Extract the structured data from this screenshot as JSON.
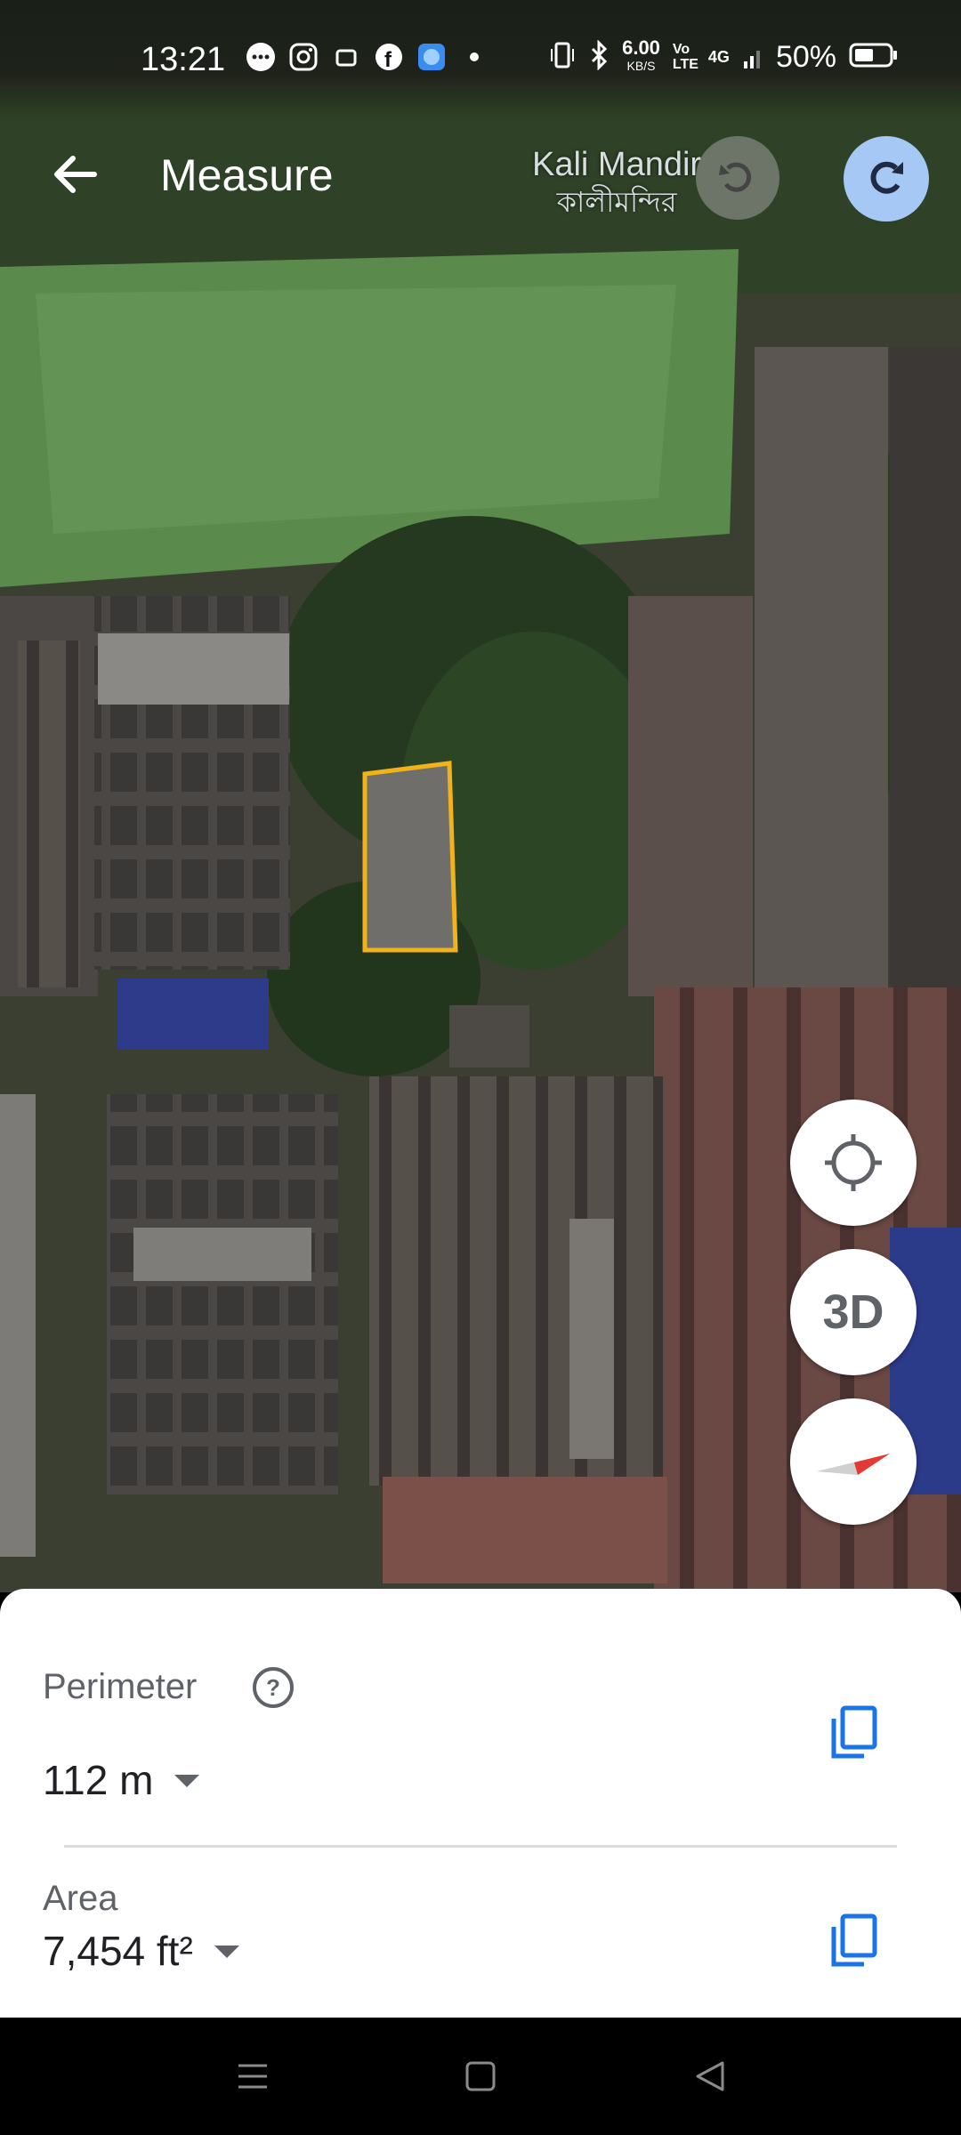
{
  "status_bar": {
    "time": "13:21",
    "speed_value": "6.00",
    "speed_unit": "KB/S",
    "volte": "Vo LTE",
    "network": "4G",
    "battery": "50%"
  },
  "app_bar": {
    "title": "Measure"
  },
  "map": {
    "place_name": "Kali Mandir",
    "place_name_local": "কালীমন্দির",
    "measure_outline_color": "#f2b21a"
  },
  "controls": {
    "three_d_label": "3D"
  },
  "sheet": {
    "perimeter_label": "Perimeter",
    "perimeter_value": "112 m",
    "area_label": "Area",
    "area_value": "7,454 ft²"
  },
  "colors": {
    "accent": "#1a73e8",
    "redo_bg": "#a6c8f4"
  }
}
